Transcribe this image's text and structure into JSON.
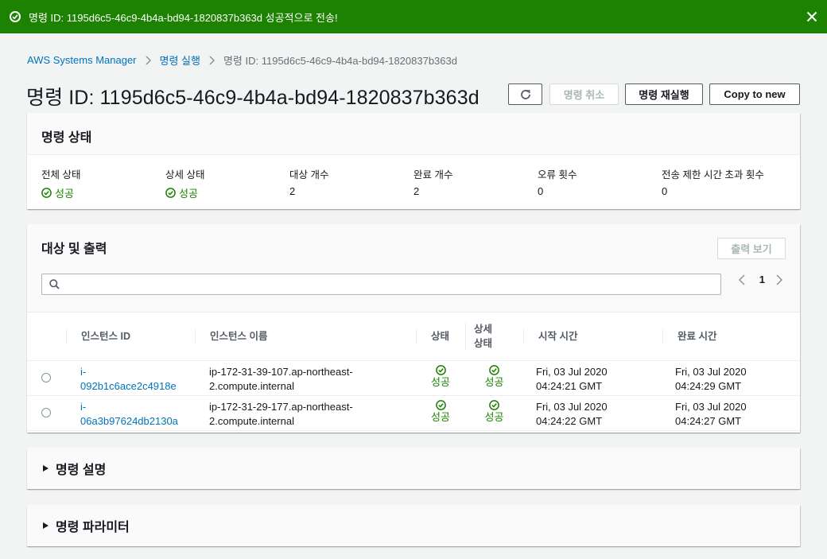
{
  "flash": {
    "message": "명령 ID: 1195d6c5-46c9-4b4a-bd94-1820837b363d 성공적으로 전송!"
  },
  "breadcrumb": [
    {
      "label": "AWS Systems Manager"
    },
    {
      "label": "명령 실행"
    },
    {
      "label": "명령 ID: 1195d6c5-46c9-4b4a-bd94-1820837b363d"
    }
  ],
  "header": {
    "title": "명령 ID: 1195d6c5-46c9-4b4a-bd94-1820837b363d",
    "cancel_label": "명령 취소",
    "rerun_label": "명령 재실행",
    "copy_label": "Copy to new"
  },
  "status_panel": {
    "title": "명령 상태",
    "fields": [
      {
        "label": "전체 상태",
        "value": "성공",
        "success": true
      },
      {
        "label": "상세 상태",
        "value": "성공",
        "success": true
      },
      {
        "label": "대상 개수",
        "value": "2"
      },
      {
        "label": "완료 개수",
        "value": "2"
      },
      {
        "label": "오류 횟수",
        "value": "0"
      },
      {
        "label": "전송 제한 시간 초과 횟수",
        "value": "0"
      }
    ]
  },
  "targets_panel": {
    "title": "대상 및 출력",
    "view_output_label": "출력 보기",
    "page": "1",
    "columns": [
      "인스턴스 ID",
      "인스턴스 이름",
      "상태",
      "상세 상태",
      "시작 시간",
      "완료 시간"
    ],
    "detail_col_line1": "상세",
    "detail_col_line2": "상태",
    "rows": [
      {
        "id_line1": "i-",
        "id_line2": "092b1c6ace2c4918e",
        "name_line1": "ip-172-31-39-107.ap-northeast-",
        "name_line2": "2.compute.internal",
        "status": "성공",
        "detail_status": "성공",
        "start_line1": "Fri, 03 Jul 2020",
        "start_line2": "04:24:21 GMT",
        "end_line1": "Fri, 03 Jul 2020",
        "end_line2": "04:24:29 GMT"
      },
      {
        "id_line1": "i-",
        "id_line2": "06a3b97624db2130a",
        "name_line1": "ip-172-31-29-177.ap-northeast-",
        "name_line2": "2.compute.internal",
        "status": "성공",
        "detail_status": "성공",
        "start_line1": "Fri, 03 Jul 2020",
        "start_line2": "04:24:22 GMT",
        "end_line1": "Fri, 03 Jul 2020",
        "end_line2": "04:24:27 GMT"
      }
    ]
  },
  "description_panel": {
    "title": "명령 설명"
  },
  "parameters_panel": {
    "title": "명령 파라미터"
  },
  "colors": {
    "success": "#1d8102",
    "link": "#0073bb",
    "flash": "#1d8102"
  },
  "icons": [
    "check-circle-icon",
    "close-icon",
    "chevron-right-icon",
    "refresh-icon",
    "search-icon",
    "chevron-left-icon",
    "caret-right-icon"
  ]
}
